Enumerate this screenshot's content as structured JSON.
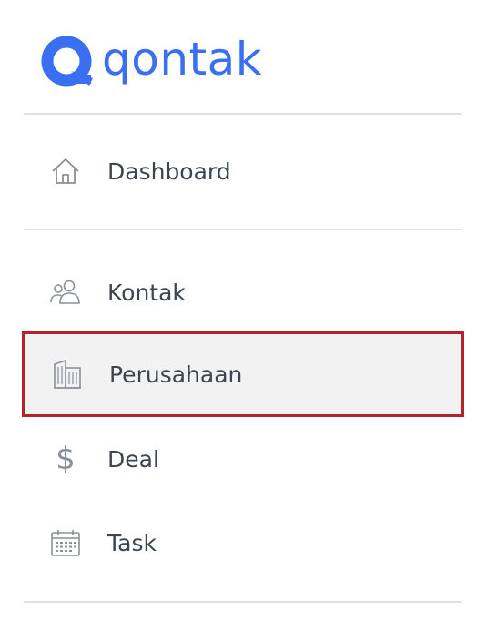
{
  "brand": {
    "name": "qontak",
    "color": "#3a6ff2"
  },
  "menu": {
    "items": [
      {
        "label": "Dashboard",
        "icon": "home-icon"
      },
      {
        "label": "Kontak",
        "icon": "contacts-icon"
      },
      {
        "label": "Perusahaan",
        "icon": "building-icon",
        "active": true
      },
      {
        "label": "Deal",
        "icon": "dollar-icon",
        "glyph": "$"
      },
      {
        "label": "Task",
        "icon": "calendar-icon"
      }
    ]
  },
  "colors": {
    "highlight_border": "#b0252b",
    "active_background": "#f2f2f2",
    "icon_gray": "#8a9097",
    "text": "#3d464f"
  }
}
